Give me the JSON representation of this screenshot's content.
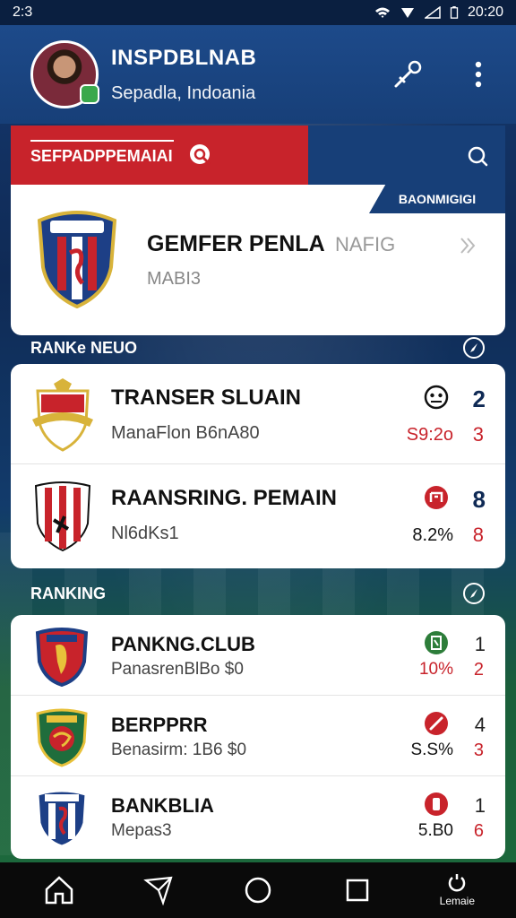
{
  "status": {
    "time": "2:3",
    "clock": "20:20"
  },
  "header": {
    "name": "INSPDBLNAB",
    "location": "Sepadla, Indoania"
  },
  "tabs": {
    "active": "SEFPADPPEMAIAI"
  },
  "featured": {
    "tag": "BAONMIGIGI",
    "title": "GEMFER PENLA",
    "subtitle_right": "NAFIG",
    "subtitle": "MABI3"
  },
  "sections": [
    {
      "title": "RANKe NEUO"
    },
    {
      "title": "RANKING"
    }
  ],
  "transfers": [
    {
      "title": "TRANSER SLUAIN",
      "subtitle": "ManaFlon B6nA80",
      "value": "S9:2o",
      "rank": "2",
      "rank2": "3"
    },
    {
      "title": "RAANSRING. PEMAIN",
      "subtitle": "Nl6dKs1",
      "value": "8.2%",
      "rank": "8",
      "rank2": "8"
    }
  ],
  "rankings": [
    {
      "title": "PANKNG.CLUB",
      "subtitle": "PanasrenBlBo $0",
      "value": "10%",
      "rank": "1",
      "rank2": "2"
    },
    {
      "title": "BERPPRR",
      "subtitle": "Benasirm: 1B6 $0",
      "value": "S.S%",
      "rank": "4",
      "rank2": "3"
    },
    {
      "title": "BANKBLIA",
      "subtitle": "Mepas3",
      "value": "5.B0",
      "rank": "1",
      "rank2": "6"
    }
  ],
  "nav": {
    "last_label": "Lemaie"
  },
  "colors": {
    "primary": "#173f78",
    "accent": "#c8232b",
    "card": "#ffffff"
  }
}
